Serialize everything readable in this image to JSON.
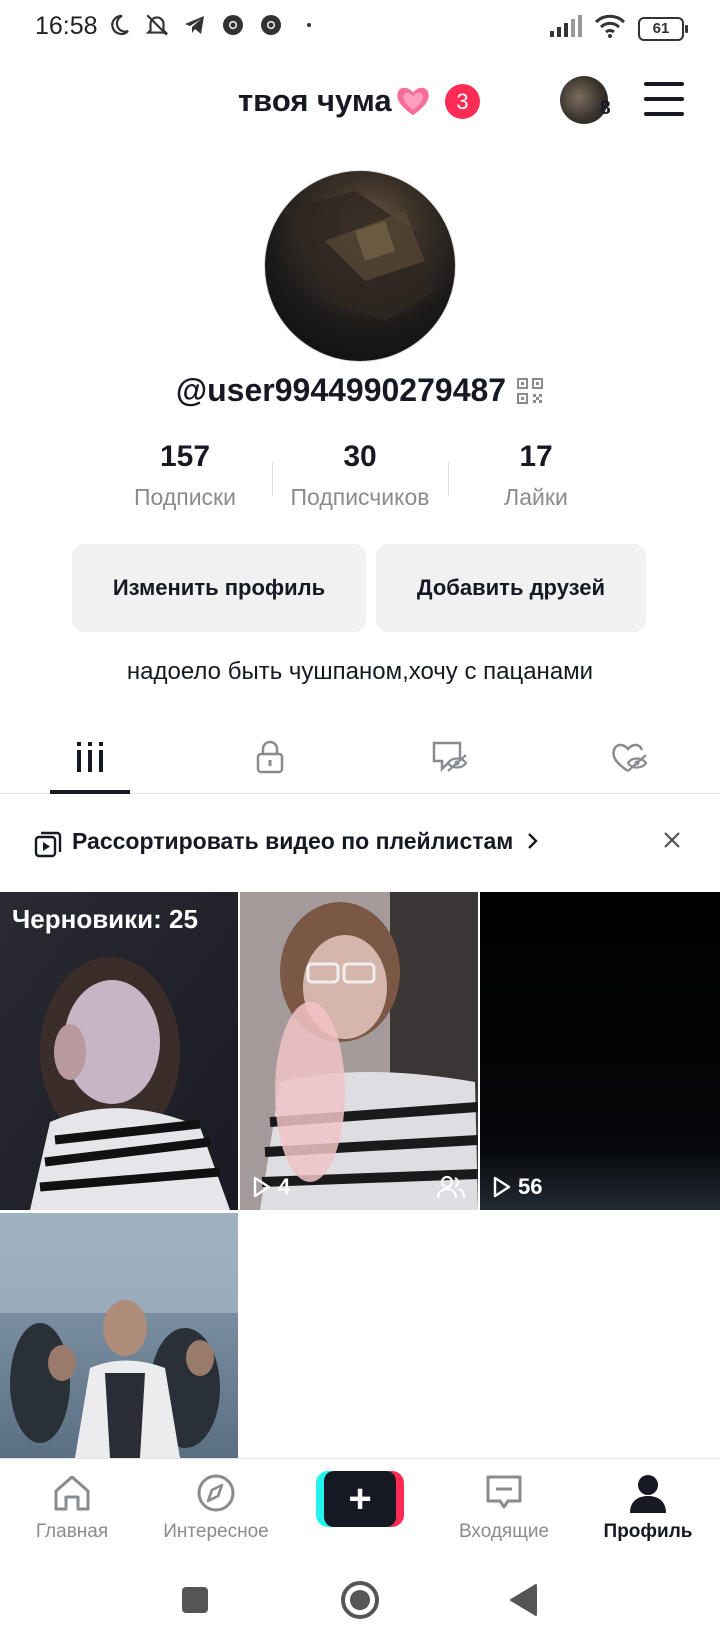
{
  "status_bar": {
    "time": "16:58",
    "battery": "61"
  },
  "header": {
    "title": "твоя чума",
    "notification_count": "3",
    "switch_account_count": "8"
  },
  "profile": {
    "username": "@user9944990279487",
    "stats": [
      {
        "value": "157",
        "label": "Подписки"
      },
      {
        "value": "30",
        "label": "Подписчиков"
      },
      {
        "value": "17",
        "label": "Лайки"
      }
    ],
    "edit_button": "Изменить профиль",
    "add_friends_button": "Добавить друзей",
    "bio": "надоело быть чушпаном,хочу с пацанами"
  },
  "tabs": [
    "videos-grid-icon",
    "lock-icon",
    "eye-off-icon",
    "heart-eye-off-icon"
  ],
  "playlist_banner": {
    "text": "Рассортировать видео по плейлистам"
  },
  "videos": [
    {
      "label": "Черновики: 25"
    },
    {
      "views": "4"
    },
    {
      "views": "56"
    },
    {}
  ],
  "bottom_nav": {
    "items": [
      {
        "label": "Главная"
      },
      {
        "label": "Интересное"
      },
      {
        "label": "Входящие"
      },
      {
        "label": "Профиль"
      }
    ]
  },
  "colors": {
    "accent_red": "#fe2c55",
    "accent_cyan": "#25f4ee",
    "text_primary": "#161823",
    "text_secondary": "#8a8b91"
  }
}
